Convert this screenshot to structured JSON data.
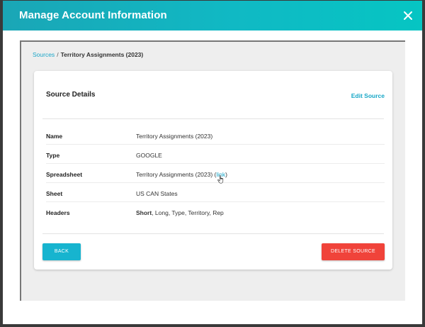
{
  "modal": {
    "title": "Manage Account Information"
  },
  "breadcrumb": {
    "parent": "Sources",
    "separator": "/",
    "current": "Territory Assignments (2023)"
  },
  "card": {
    "title": "Source Details",
    "edit_label": "Edit Source"
  },
  "details": {
    "name": {
      "label": "Name",
      "value": "Territory Assignments (2023)"
    },
    "type": {
      "label": "Type",
      "value": "GOOGLE"
    },
    "spreadsheet": {
      "label": "Spreadsheet",
      "value": "Territory Assignments (2023)",
      "link_open": " (",
      "link_label": "link",
      "link_close": ")"
    },
    "sheet": {
      "label": "Sheet",
      "value": "US CAN States"
    },
    "headers": {
      "label": "Headers",
      "first": "Short",
      "rest": ", Long, Type, Territory, Rep"
    }
  },
  "actions": {
    "back_label": "BACK",
    "delete_label": "DELETE SOURCE"
  },
  "colors": {
    "header_gradient_start": "#1aa6b6",
    "header_gradient_end": "#06c5c3",
    "link": "#1aa6c8",
    "back_button": "#17b4cf",
    "delete_button": "#f0433a"
  },
  "icons": {
    "close": "close-icon",
    "cursor": "hand-pointer-icon"
  }
}
